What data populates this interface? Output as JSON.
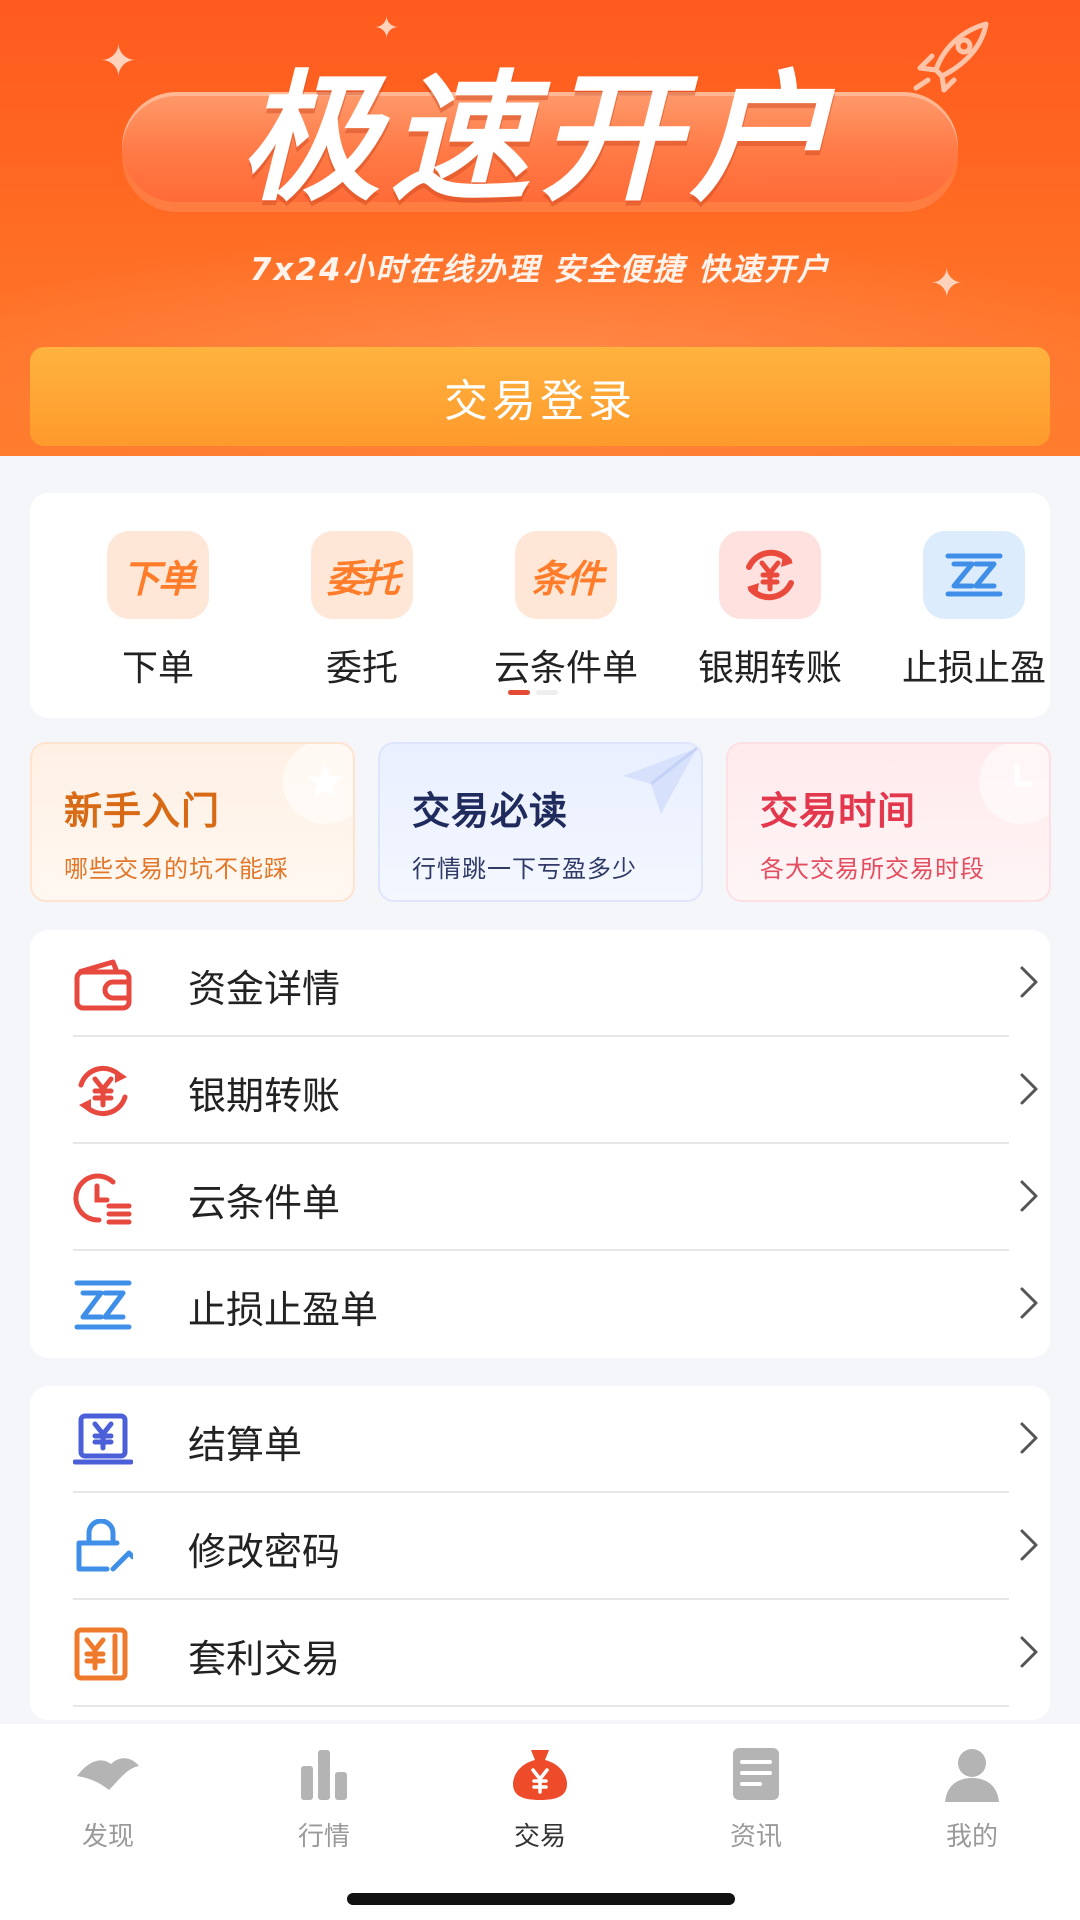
{
  "banner": {
    "title": "极速开户",
    "subtitle": "7x24小时在线办理  安全便捷  快速开户",
    "login_button": "交易登录"
  },
  "quick_actions": [
    {
      "icon_text": "下单",
      "label": "下单",
      "icon": "order-icon"
    },
    {
      "icon_text": "委托",
      "label": "委托",
      "icon": "entrust-icon"
    },
    {
      "icon_text": "条件",
      "label": "云条件单",
      "icon": "condition-icon"
    },
    {
      "icon_text": "",
      "label": "银期转账",
      "icon": "yen-transfer-icon"
    },
    {
      "icon_text": "",
      "label": "止损止盈",
      "icon": "stop-loss-icon"
    }
  ],
  "guides": [
    {
      "title": "新手入门",
      "subtitle": "哪些交易的坑不能踩",
      "icon": "star-icon"
    },
    {
      "title": "交易必读",
      "subtitle": "行情跳一下亏盈多少",
      "icon": "paper-plane-icon"
    },
    {
      "title": "交易时间",
      "subtitle": "各大交易所交易时段",
      "icon": "clock-icon"
    }
  ],
  "menu_group_1": [
    {
      "label": "资金详情",
      "icon": "wallet-icon"
    },
    {
      "label": "银期转账",
      "icon": "yen-transfer-icon"
    },
    {
      "label": "云条件单",
      "icon": "clock-list-icon"
    },
    {
      "label": "止损止盈单",
      "icon": "stop-loss-icon"
    }
  ],
  "menu_group_2": [
    {
      "label": "结算单",
      "icon": "settlement-icon"
    },
    {
      "label": "修改密码",
      "icon": "lock-edit-icon"
    },
    {
      "label": "套利交易",
      "icon": "arbitrage-icon"
    }
  ],
  "tabs": [
    {
      "label": "发现",
      "icon": "discover-icon",
      "active": false
    },
    {
      "label": "行情",
      "icon": "market-icon",
      "active": false
    },
    {
      "label": "交易",
      "icon": "trade-icon",
      "active": true
    },
    {
      "label": "资讯",
      "icon": "news-icon",
      "active": false
    },
    {
      "label": "我的",
      "icon": "profile-icon",
      "active": false
    }
  ],
  "colors": {
    "brand_orange": "#ff5a1f",
    "login_button": "#ffa836",
    "list_icon_red": "#e8493f",
    "list_icon_blue": "#3f8fe8",
    "list_icon_indigo": "#4b5fd8",
    "active_tab": "#ee4b2b"
  }
}
